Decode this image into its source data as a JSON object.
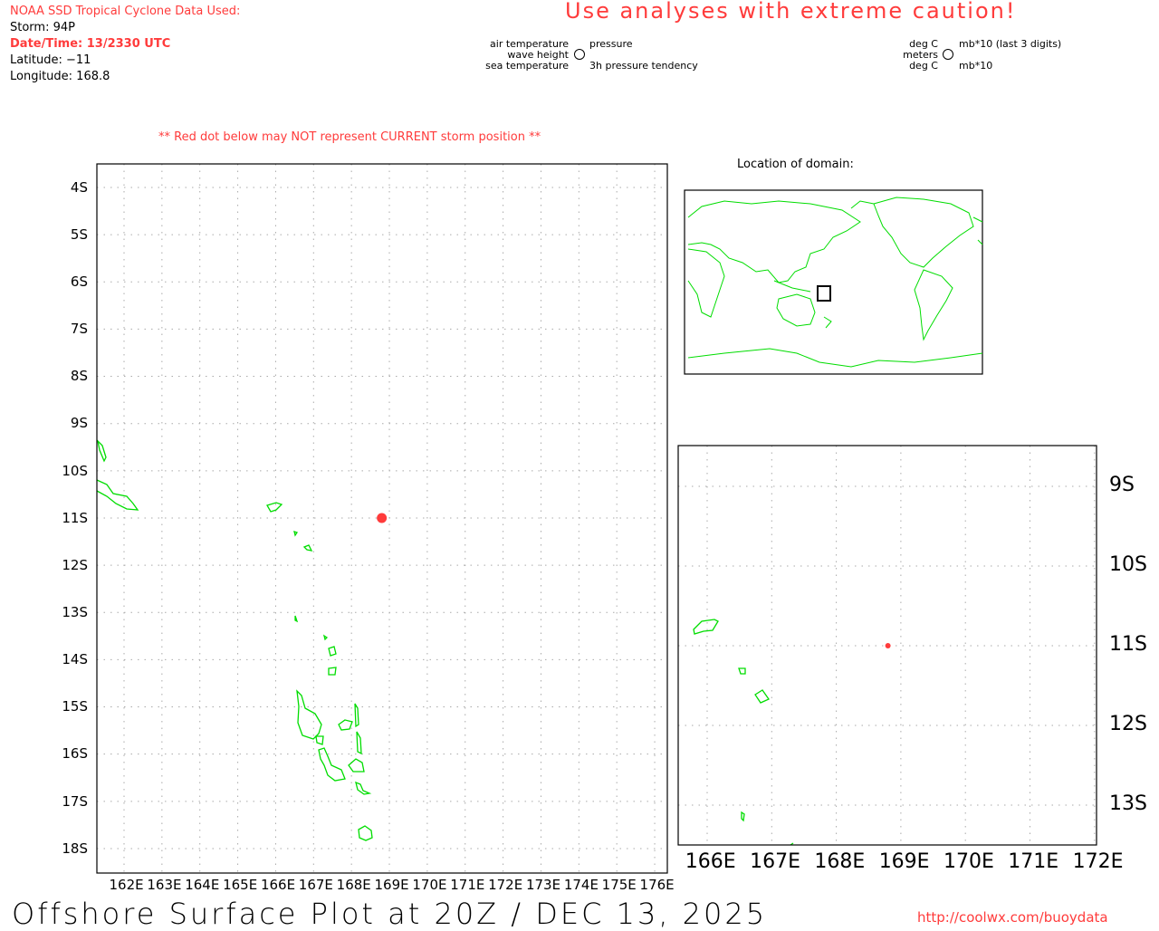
{
  "header": {
    "source": "NOAA SSD Tropical Cyclone Data Used:",
    "storm": "Storm: 94P",
    "datetime": "Date/Time: 13/2330 UTC",
    "latitude": "Latitude: −11",
    "longitude": "Longitude: 168.8",
    "caution": "Use analyses with extreme caution!",
    "warning": "** Red dot below may NOT represent CURRENT storm position **"
  },
  "legend": {
    "air_temperature": "air temperature",
    "wave_height": "wave height",
    "sea_temperature": "sea temperature",
    "pressure": "pressure",
    "pressure_tendency": "3h pressure tendency",
    "unit_air": "deg C",
    "unit_wave": "meters",
    "unit_sea": "deg C",
    "unit_pressure": "mb*10 (last 3 digits)",
    "unit_tendency": "mb*10"
  },
  "inset": {
    "title": "Location of domain:"
  },
  "main_map": {
    "lon_ticks": [
      "162E",
      "163E",
      "164E",
      "165E",
      "166E",
      "167E",
      "168E",
      "169E",
      "170E",
      "171E",
      "172E",
      "173E",
      "174E",
      "175E",
      "176E"
    ],
    "lat_ticks": [
      "4S",
      "5S",
      "6S",
      "7S",
      "8S",
      "9S",
      "10S",
      "11S",
      "12S",
      "13S",
      "14S",
      "15S",
      "16S",
      "17S",
      "18S"
    ]
  },
  "zoom_map": {
    "lon_ticks": [
      "166E",
      "167E",
      "168E",
      "169E",
      "170E",
      "171E",
      "172E"
    ],
    "lat_ticks": [
      "9S",
      "10S",
      "11S",
      "12S",
      "13S"
    ]
  },
  "storm_position": {
    "lat": -11,
    "lon": 168.8
  },
  "colors": {
    "storm_dot": "#ff3b3b",
    "coastline": "#00dd00",
    "grid": "#aaaaaa",
    "title_red": "#ff3b3b"
  },
  "footer": {
    "title": "Offshore Surface Plot at 20Z / DEC 13, 2025",
    "url": "http://coolwx.com/buoydata"
  }
}
